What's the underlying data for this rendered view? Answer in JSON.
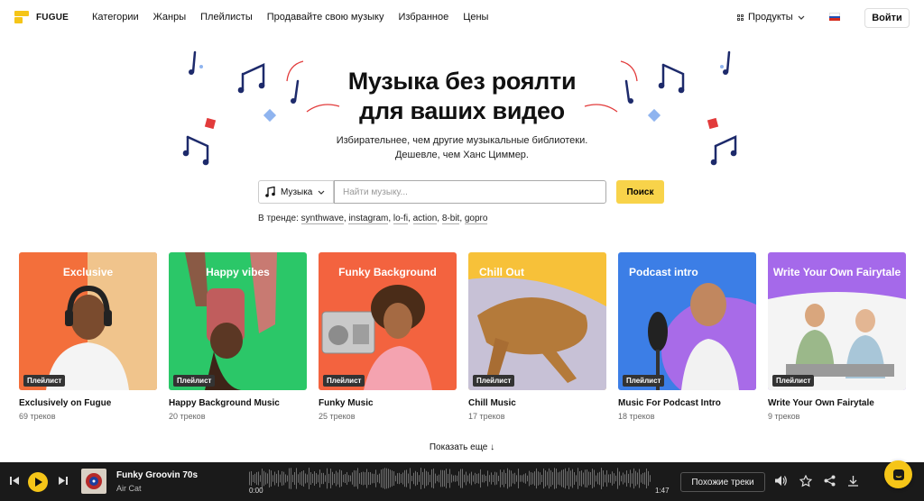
{
  "header": {
    "logo_text": "FUGUE",
    "nav": [
      "Категории",
      "Жанры",
      "Плейлисты",
      "Продавайте свою музыку",
      "Избранное",
      "Цены"
    ],
    "products_label": "Продукты",
    "login_label": "Войти"
  },
  "hero": {
    "title_line1": "Музыка без роялти",
    "title_line2": "для ваших видео",
    "subtitle_line1": "Избирательнее, чем другие музыкальные библиотеки.",
    "subtitle_line2": "Дешевле, чем Ханс Циммер."
  },
  "search": {
    "genre_label": "Музыка",
    "placeholder": "Найти музыку...",
    "button_label": "Поиск",
    "trending_label": "В тренде:",
    "trending_tags": [
      "synthwave",
      "instagram",
      "lo-fi",
      "action",
      "8-bit",
      "gopro"
    ]
  },
  "cards": [
    {
      "label": "Exclusive",
      "badge": "Плейлист",
      "title": "Exclusively on Fugue",
      "count": "69 треков",
      "bg": "#f36f3b"
    },
    {
      "label": "Happy vibes",
      "badge": "Плейлист",
      "title": "Happy Background Music",
      "count": "20 треков",
      "bg": "#2bc768"
    },
    {
      "label": "Funky Background",
      "badge": "Плейлист",
      "title": "Funky Music",
      "count": "25 треков",
      "bg": "#f3633f"
    },
    {
      "label": "Chill Out",
      "badge": "Плейлист",
      "title": "Chill Music",
      "count": "17 треков",
      "bg": "#f7c139"
    },
    {
      "label": "Podcast intro",
      "badge": "Плейлист",
      "title": "Music For Podcast Intro",
      "count": "18 треков",
      "bg": "#3c7ee6"
    },
    {
      "label": "Write Your Own Fairytale",
      "badge": "Плейлист",
      "title": "Write Your Own Fairytale",
      "count": "9 треков",
      "bg": "#a569ea"
    }
  ],
  "show_more_label": "Показать еще ↓",
  "player": {
    "track_name": "Funky Groovin 70s",
    "artist": "Air Cat",
    "time_start": "0:00",
    "time_end": "1:47",
    "similar_label": "Похожие треки"
  },
  "colors": {
    "accent": "#f5c518",
    "player_bg": "#1a1a1a",
    "note_color": "#1d2a6b",
    "deco_red": "#e23b3b",
    "deco_blue": "#8fb4ef"
  }
}
